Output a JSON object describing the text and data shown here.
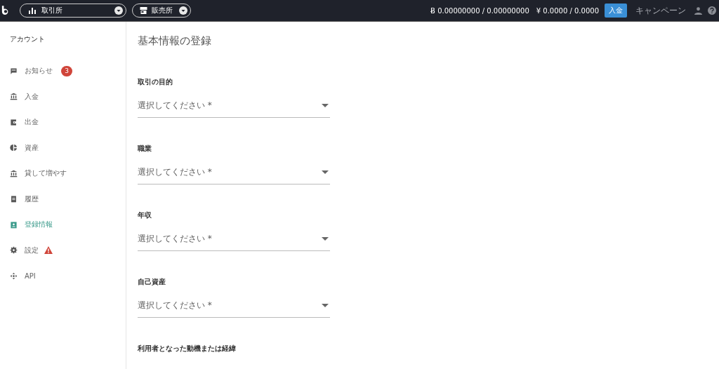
{
  "topbar": {
    "markets": [
      {
        "label": "取引所"
      },
      {
        "label": "販売所"
      }
    ],
    "btc_balance": "0.00000000 / 0.00000000",
    "btc_symbol": "Ƀ",
    "jpy_symbol": "¥",
    "jpy_balance": "0.0000 / 0.0000",
    "deposit_button": "入金",
    "campaign_link": "キャンペーン"
  },
  "sidebar": {
    "heading": "アカウント",
    "items": [
      {
        "label": "お知らせ",
        "selected": false,
        "badge": "3",
        "warning": false
      },
      {
        "label": "入金",
        "selected": false,
        "warning": false
      },
      {
        "label": "出金",
        "selected": false,
        "warning": false
      },
      {
        "label": "資産",
        "selected": false,
        "warning": false
      },
      {
        "label": "貸して増やす",
        "selected": false,
        "warning": false
      },
      {
        "label": "履歴",
        "selected": false,
        "warning": false
      },
      {
        "label": "登録情報",
        "selected": true,
        "warning": false
      },
      {
        "label": "設定",
        "selected": false,
        "warning": true
      },
      {
        "label": "API",
        "selected": false,
        "warning": false
      }
    ]
  },
  "form": {
    "title": "基本情報の登録",
    "fields": [
      {
        "label": "取引の目的",
        "placeholder": "選択してください *"
      },
      {
        "label": "職業",
        "placeholder": "選択してください *"
      },
      {
        "label": "年収",
        "placeholder": "選択してください *"
      },
      {
        "label": "自己資産",
        "placeholder": "選択してください *"
      }
    ],
    "next_label": "利用者となった動機または経緯"
  }
}
